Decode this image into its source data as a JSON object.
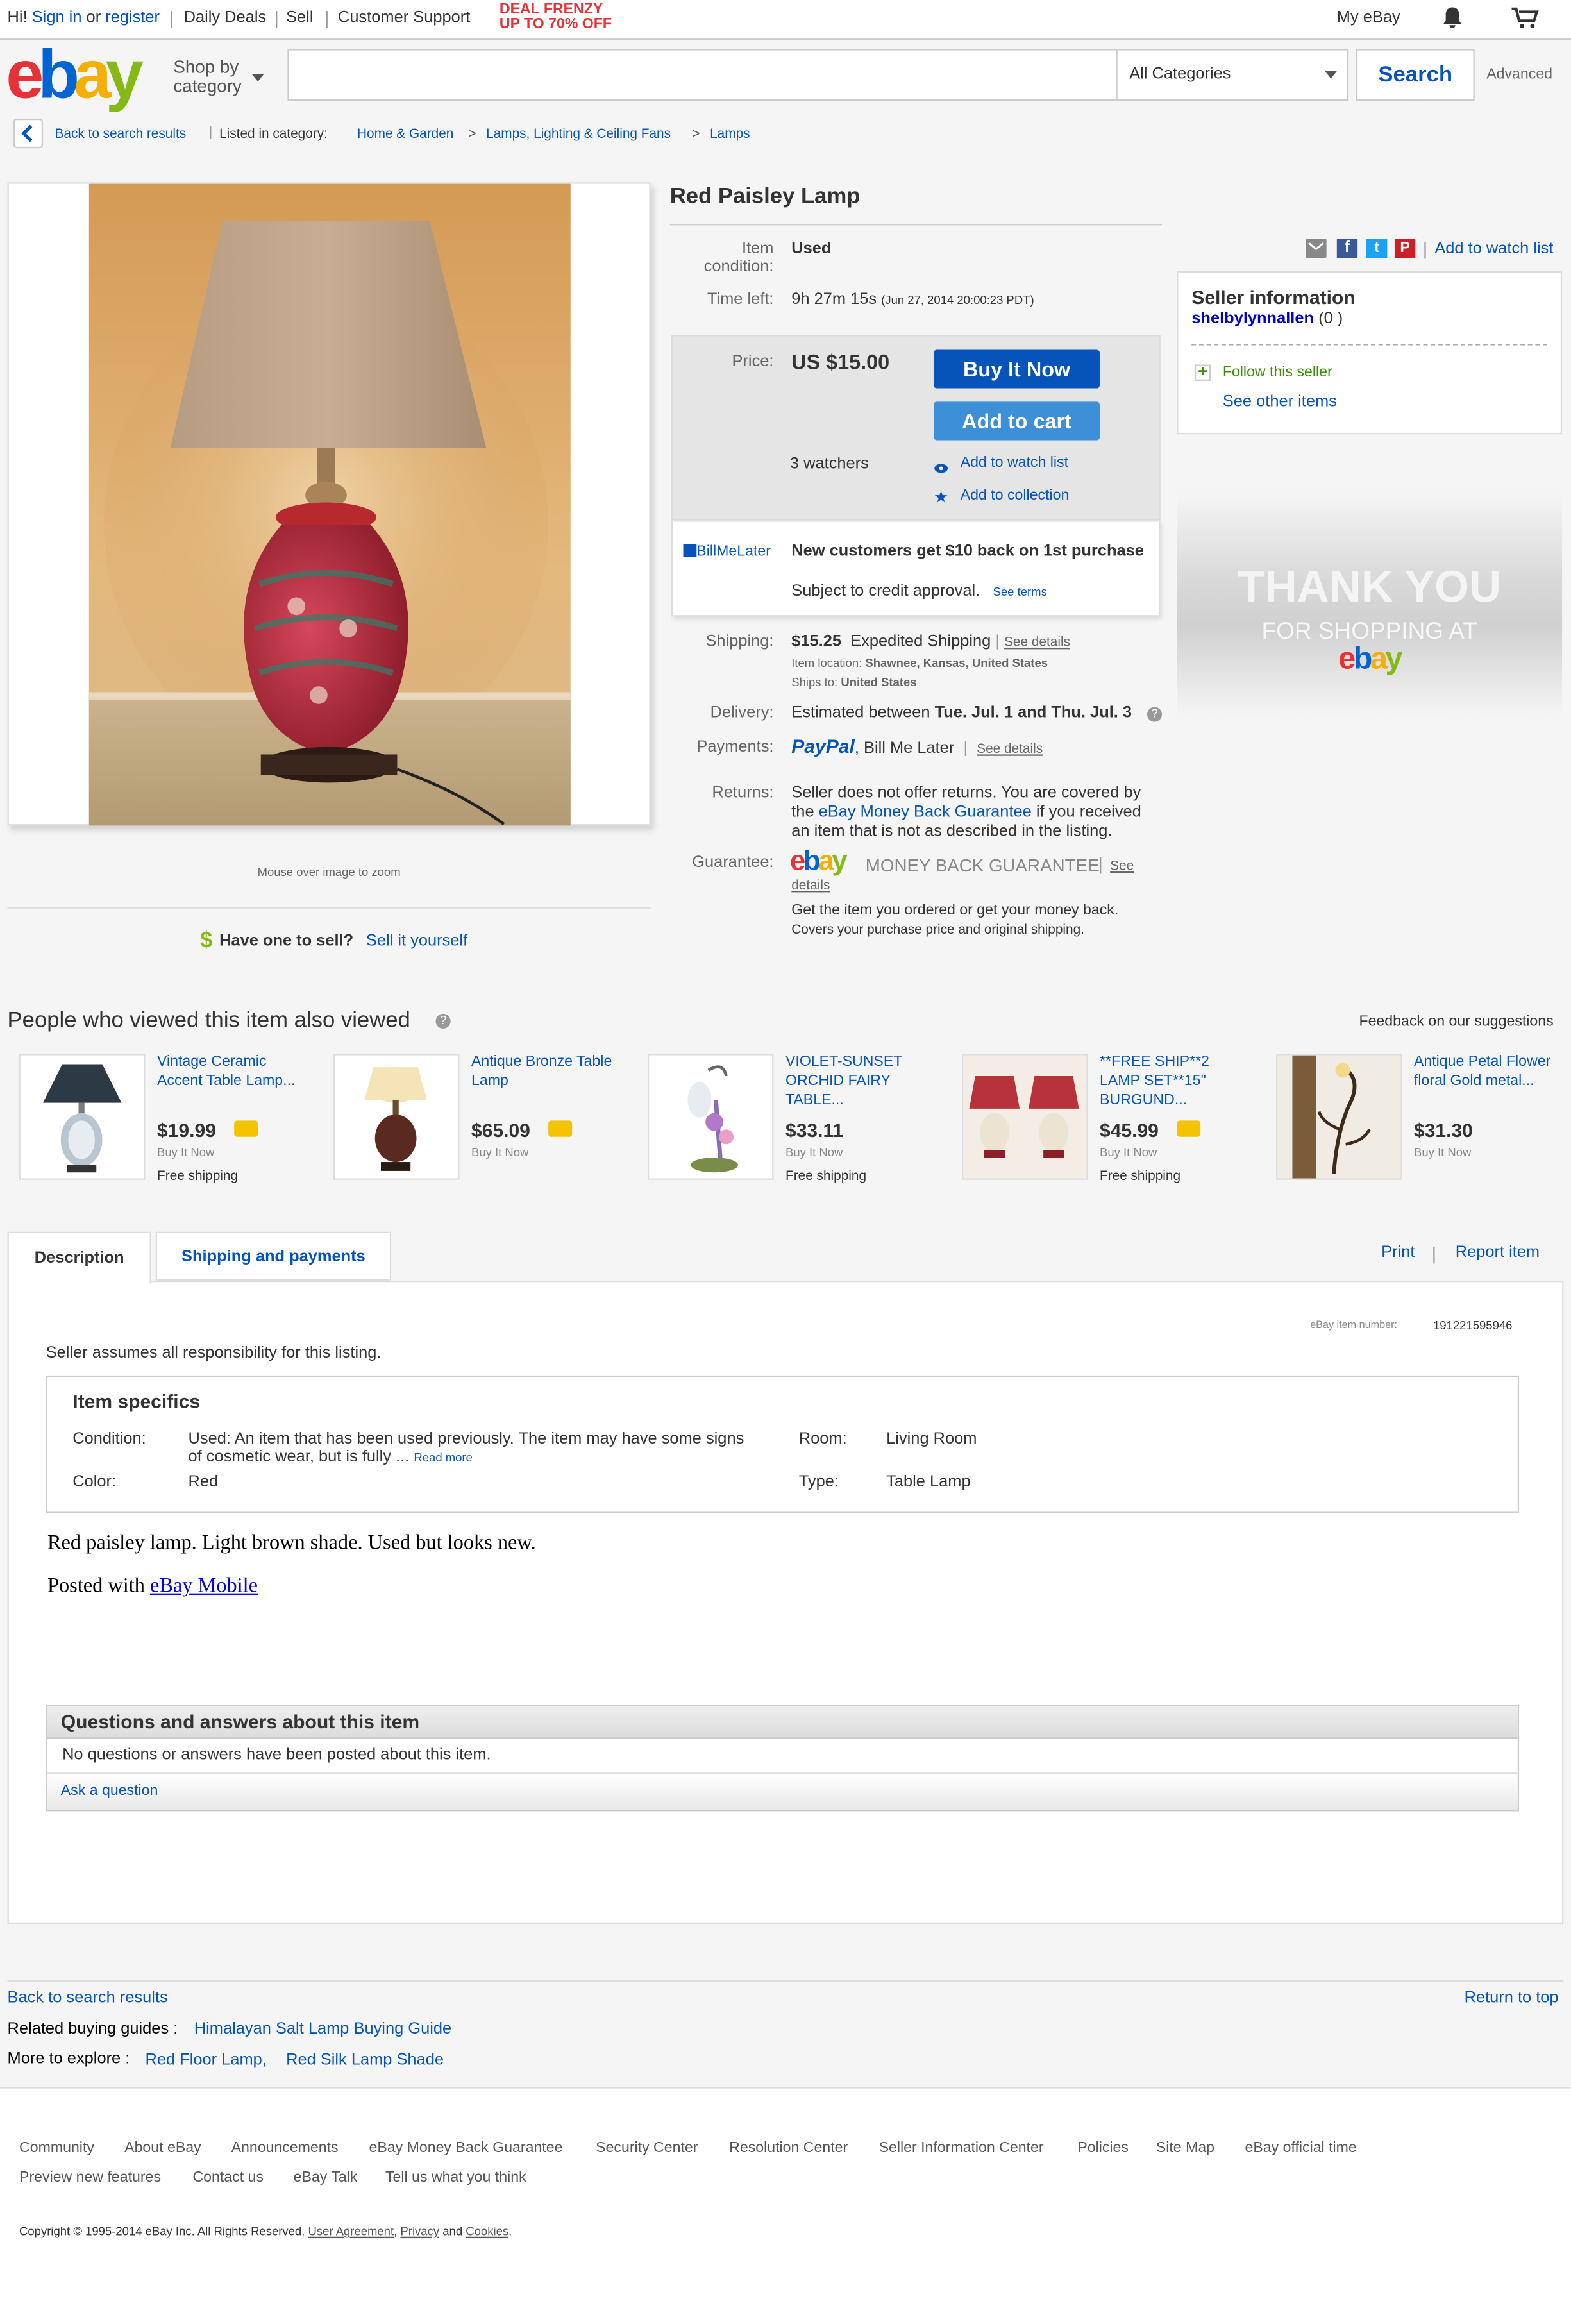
{
  "colors": {
    "brand_red": "#e53238",
    "brand_blue": "#0064d2",
    "brand_yellow": "#f5af02",
    "brand_green": "#86b817",
    "link": "#0654ba",
    "button": "#0654ba",
    "price_bg": "#e5e5e5"
  },
  "topbar": {
    "greeting": "Hi!",
    "sign_in": "Sign in",
    "or": "or",
    "register": "register",
    "daily_deals": "Daily Deals",
    "sell": "Sell",
    "customer_support": "Customer Support",
    "promo_line1": "DEAL FRENZY",
    "promo_line2": "UP TO 70% OFF",
    "my_ebay": "My eBay",
    "icons": [
      "bell-icon",
      "cart-icon"
    ]
  },
  "header": {
    "logo": "ebay",
    "shop_by_1": "Shop by",
    "shop_by_2": "category",
    "search_placeholder": "",
    "category_selected": "All Categories",
    "search_button": "Search",
    "advanced": "Advanced"
  },
  "breadcrumb": {
    "back": "Back to search results",
    "listed_in": "Listed in category:",
    "items": [
      "Home & Garden",
      "Lamps, Lighting & Ceiling Fans",
      "Lamps"
    ],
    "separator": ">"
  },
  "gallery": {
    "zoom_hint": "Mouse over image to zoom",
    "have_one": "Have one to sell?",
    "sell_it": "Sell it yourself",
    "dollar": "$"
  },
  "item": {
    "title": "Red Paisley Lamp",
    "condition_label_1": "Item",
    "condition_label_2": "condition:",
    "condition": "Used",
    "time_left_label": "Time left:",
    "time_left": "9h 27m 15s",
    "time_end": "(Jun 27, 2014   20:00:23 PDT)",
    "price_label": "Price:",
    "price": "US $15.00",
    "buy_it_now": "Buy It Now",
    "add_to_cart": "Add to cart",
    "watchers": "3 watchers",
    "add_watch": "Add to watch list",
    "add_collection": "Add to collection",
    "bml_logo": "BillMeLater",
    "bml_title": "New customers get $10 back on 1st purchase",
    "bml_sub": "Subject to credit approval.",
    "bml_terms": "See terms",
    "shipping_label": "Shipping:",
    "shipping_price": "$15.25",
    "shipping_method": "Expedited Shipping",
    "see_details": "See details",
    "item_location_label": "Item location:",
    "item_location": "Shawnee, Kansas, United States",
    "ships_to_label": "Ships to:",
    "ships_to": "United States",
    "delivery_label": "Delivery:",
    "delivery_text": "Estimated between",
    "delivery_dates": "Tue. Jul. 1 and Thu. Jul. 3",
    "payments_label": "Payments:",
    "paypal": "PayPal",
    "bill_me_later": "Bill Me Later",
    "returns_label": "Returns:",
    "returns_1": "Seller does not offer returns. You are covered by",
    "returns_2a": "the",
    "returns_link": "eBay Money Back Guarantee",
    "returns_2b": "if you received",
    "returns_3": "an item that is not as described in the listing.",
    "guarantee_label": "Guarantee:",
    "mbg": "MONEY BACK GUARANTEE",
    "see": "See",
    "details": "details",
    "guarantee_1": "Get the item you ordered or get your money back.",
    "guarantee_2": "Covers your purchase price and original shipping."
  },
  "share": {
    "icons": [
      "email-icon",
      "facebook-icon",
      "twitter-icon",
      "pinterest-icon"
    ],
    "add_watch": "Add to watch list"
  },
  "seller": {
    "heading": "Seller information",
    "name": "shelbylynnallen",
    "feedback": "(0 )",
    "follow": "Follow this seller",
    "see_other": "See other items"
  },
  "thankyou": {
    "line1": "THANK YOU",
    "line2": "FOR SHOPPING AT",
    "logo": "ebay"
  },
  "also_viewed": {
    "heading": "People who viewed this item also viewed",
    "feedback": "Feedback on our suggestions",
    "items": [
      {
        "title1": "Vintage Ceramic",
        "title2": "Accent Table Lamp...",
        "title3": "",
        "price": "$19.99",
        "type": "Buy It Now",
        "shipping": "Free shipping",
        "badge": true
      },
      {
        "title1": "Antique Bronze Table",
        "title2": "Lamp",
        "title3": "",
        "price": "$65.09",
        "type": "Buy It Now",
        "shipping": "",
        "badge": true
      },
      {
        "title1": "VIOLET-SUNSET",
        "title2": "ORCHID FAIRY",
        "title3": "TABLE...",
        "price": "$33.11",
        "type": "Buy It Now",
        "shipping": "Free shipping",
        "badge": false
      },
      {
        "title1": "**FREE SHIP**2",
        "title2": "LAMP SET**15\"",
        "title3": "BURGUND...",
        "price": "$45.99",
        "type": "Buy It Now",
        "shipping": "Free shipping",
        "badge": true
      },
      {
        "title1": "Antique Petal Flower",
        "title2": "floral Gold metal...",
        "title3": "",
        "price": "$31.30",
        "type": "Buy It Now",
        "shipping": "",
        "badge": false
      }
    ]
  },
  "tabs": {
    "description": "Description",
    "shipping": "Shipping and payments",
    "print": "Print",
    "report": "Report item"
  },
  "description": {
    "item_number_label": "eBay item number:",
    "item_number": "191221595946",
    "seller_assumes": "Seller assumes all responsibility for this listing.",
    "specifics_title": "Item specifics",
    "condition_label": "Condition:",
    "condition_1": "Used: An item that has been used previously. The item may have some signs",
    "condition_2": "of cosmetic wear, but is fully ...",
    "read_more": "Read more",
    "room_label": "Room:",
    "room": "Living Room",
    "color_label": "Color:",
    "color": "Red",
    "type_label": "Type:",
    "type": "Table Lamp",
    "body": "Red paisley lamp. Light brown shade. Used but looks new.",
    "posted_with": "Posted with",
    "ebay_mobile": "eBay Mobile"
  },
  "qa": {
    "heading": "Questions and answers about this item",
    "none": "No questions or answers have been posted about this item.",
    "ask": "Ask a question"
  },
  "bottom": {
    "back": "Back to search results",
    "return_top": "Return to top",
    "guides_label": "Related buying guides :",
    "guide": "Himalayan Salt Lamp Buying Guide",
    "explore_label": "More to explore :",
    "explore_1": "Red Floor Lamp,",
    "explore_2": "Red Silk Lamp Shade"
  },
  "footer": {
    "links_row1": [
      "Community",
      "About eBay",
      "Announcements",
      "eBay Money Back Guarantee",
      "Security Center",
      "Resolution Center",
      "Seller Information Center",
      "Policies",
      "Site Map",
      "eBay official time"
    ],
    "links_row2": [
      "Preview new features",
      "Contact us",
      "eBay Talk",
      "Tell us what you think"
    ],
    "copyright": "Copyright © 1995-2014 eBay Inc. All Rights Reserved.",
    "user_agreement": "User Agreement",
    "privacy": "Privacy",
    "and": "and",
    "cookies": "Cookies"
  }
}
